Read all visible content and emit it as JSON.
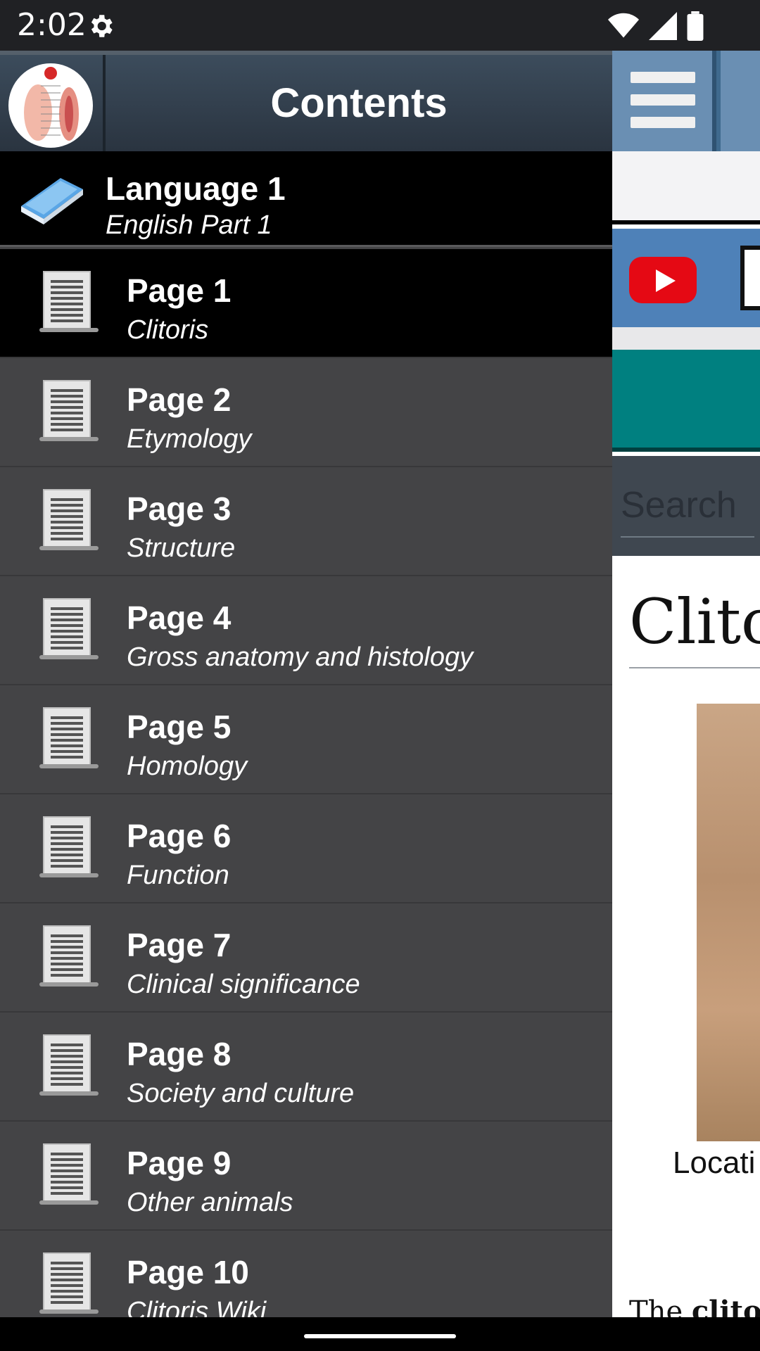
{
  "status_bar": {
    "time": "2:02"
  },
  "drawer": {
    "title": "Contents",
    "language": {
      "title": "Language 1",
      "subtitle": "English Part 1"
    },
    "items": [
      {
        "title": "Page 1",
        "subtitle": "Clitoris"
      },
      {
        "title": "Page 2",
        "subtitle": "Etymology"
      },
      {
        "title": "Page 3",
        "subtitle": "Structure"
      },
      {
        "title": "Page 4",
        "subtitle": "Gross anatomy and histology"
      },
      {
        "title": "Page 5",
        "subtitle": "Homology"
      },
      {
        "title": "Page 6",
        "subtitle": "Function"
      },
      {
        "title": "Page 7",
        "subtitle": "Clinical significance"
      },
      {
        "title": "Page 8",
        "subtitle": "Society and culture"
      },
      {
        "title": "Page 9",
        "subtitle": "Other animals"
      },
      {
        "title": "Page 10",
        "subtitle": "Clitoris Wiki"
      }
    ],
    "active_index": 0
  },
  "background_page": {
    "search_placeholder": "Search",
    "title_fragment": "Clito",
    "caption_fragment": "Locati",
    "body_fragment_prefix": "The ",
    "body_fragment_bold": "clitori"
  },
  "colors": {
    "drawer_bg": "#444446",
    "active_row_bg": "#000000",
    "header_bg": "#2f3a46",
    "teal_bar": "#008080",
    "blue_bar": "#4e81b8"
  }
}
